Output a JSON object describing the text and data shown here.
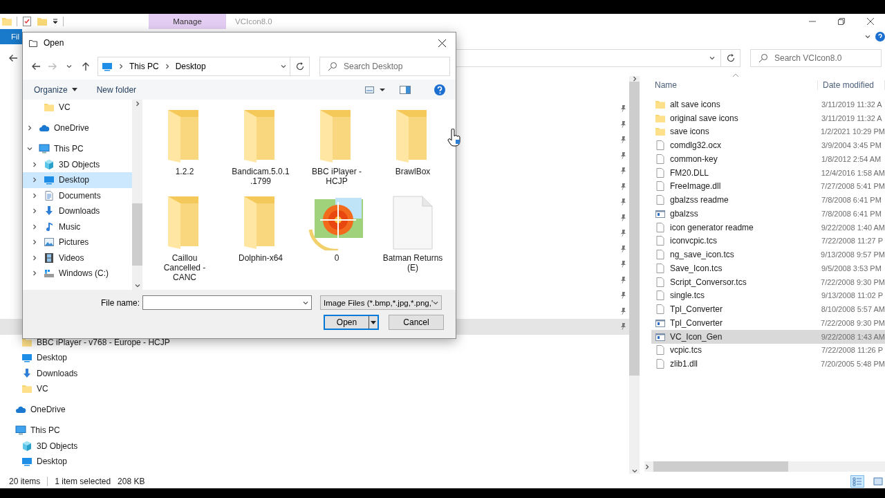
{
  "explorer": {
    "title": "VCIcon8.0",
    "context_tab": "Manage",
    "ribbon_tab": "Fil",
    "search": {
      "placeholder": "Search VCIcon8.0"
    },
    "nav": [
      {
        "children": [
          {
            "pinned": true,
            "selected": false
          },
          {
            "pinned": true,
            "selected": false
          },
          {
            "pinned": true,
            "selected": false
          },
          {
            "pinned": true,
            "selected": false
          },
          {
            "pinned": true,
            "selected": false
          },
          {
            "pinned": true,
            "selected": false
          },
          {
            "pinned": true,
            "selected": false
          },
          {
            "pinned": true,
            "selected": false
          },
          {
            "pinned": true,
            "selected": false
          },
          {
            "pinned": true,
            "selected": false
          },
          {
            "pinned": true,
            "selected": false
          },
          {
            "pinned": true,
            "selected": false
          },
          {
            "pinned": true,
            "selected": false
          },
          {
            "pinned": true,
            "selected": false
          },
          {
            "pinned": true,
            "selected": true
          },
          {
            "label": "BBC iPlayer - v768 - Europe - HCJP",
            "kind": "folder",
            "pinned": false,
            "selected": false
          },
          {
            "label": "Desktop",
            "kind": "desktop",
            "pinned": false,
            "selected": false
          },
          {
            "label": "Downloads",
            "kind": "downloads",
            "pinned": false,
            "selected": false
          },
          {
            "label": "VC",
            "kind": "folder",
            "pinned": false,
            "selected": false
          }
        ]
      },
      {
        "label": "OneDrive",
        "kind": "cloud",
        "selected": false
      },
      {
        "label": "This PC",
        "kind": "pc",
        "selected": false,
        "children": [
          {
            "label": "3D Objects",
            "kind": "cube",
            "selected": false
          },
          {
            "label": "Desktop",
            "kind": "desktop",
            "selected": false
          }
        ]
      }
    ],
    "columns": [
      "Name",
      "Date modified"
    ],
    "files": [
      {
        "name": "alt save icons",
        "date": "3/11/2019 11:32 A",
        "kind": "folder",
        "selected": false
      },
      {
        "name": "original save icons",
        "date": "3/11/2019 11:32 A",
        "kind": "folder",
        "selected": false
      },
      {
        "name": "save icons",
        "date": "1/2/2021 10:29 PM",
        "kind": "folder",
        "selected": false
      },
      {
        "name": "comdlg32.ocx",
        "date": "3/9/2004 3:45 PM",
        "kind": "file",
        "selected": false
      },
      {
        "name": "common-key",
        "date": "1/8/2012 2:54 AM",
        "kind": "file",
        "selected": false
      },
      {
        "name": "FM20.DLL",
        "date": "12/4/2016 1:58 AM",
        "kind": "file",
        "selected": false
      },
      {
        "name": "FreeImage.dll",
        "date": "7/27/2008 5:41 PM",
        "kind": "file",
        "selected": false
      },
      {
        "name": "gbalzss readme",
        "date": "7/8/2008 6:41 PM",
        "kind": "file",
        "selected": false
      },
      {
        "name": "gbalzss",
        "date": "7/8/2008 6:41 PM",
        "kind": "app",
        "selected": false
      },
      {
        "name": "icon generator readme",
        "date": "9/22/2008 1:40 AM",
        "kind": "file",
        "selected": false
      },
      {
        "name": "iconvcpic.tcs",
        "date": "7/22/2008 11:27 P",
        "kind": "file",
        "selected": false
      },
      {
        "name": "ng_save_icon.tcs",
        "date": "9/13/2008 9:57 PM",
        "kind": "file",
        "selected": false
      },
      {
        "name": "Save_Icon.tcs",
        "date": "9/5/2008 3:53 PM",
        "kind": "file",
        "selected": false
      },
      {
        "name": "Script_Conversor.tcs",
        "date": "7/22/2008 9:30 PM",
        "kind": "file",
        "selected": false
      },
      {
        "name": "single.tcs",
        "date": "9/13/2008 11:02 P",
        "kind": "file",
        "selected": false
      },
      {
        "name": "Tpl_Converter",
        "date": "8/10/2008 5:57 AM",
        "kind": "file",
        "selected": false
      },
      {
        "name": "Tpl_Converter",
        "date": "7/22/2008 9:30 PM",
        "kind": "app",
        "selected": false
      },
      {
        "name": "VC_Icon_Gen",
        "date": "9/22/2008 1:43 AM",
        "kind": "app",
        "selected": true
      },
      {
        "name": "vcpic.tcs",
        "date": "7/22/2008 11:26 P",
        "kind": "file",
        "selected": false
      },
      {
        "name": "zlib1.dll",
        "date": "7/20/2005 5:48 PM",
        "kind": "file",
        "selected": false
      }
    ],
    "status": {
      "count": "20 items",
      "selection": "1 item selected",
      "size": "208 KB"
    },
    "view_buttons": [
      {
        "kind": "details",
        "selected": true
      },
      {
        "kind": "large-icons",
        "selected": false
      }
    ]
  },
  "dialog": {
    "title": "Open",
    "back": {
      "disabled": false
    },
    "forward": {
      "disabled": true
    },
    "breadcrumb": [
      "This PC",
      "Desktop"
    ],
    "search": {
      "placeholder": "Search Desktop"
    },
    "organize": "Organize",
    "new_folder": "New folder",
    "tree": [
      {
        "children": [
          {
            "label": "VC",
            "kind": "folder",
            "selected": false
          }
        ]
      },
      {
        "label": "OneDrive",
        "kind": "cloud",
        "expanded": false,
        "selected": false
      },
      {
        "label": "This PC",
        "kind": "pc",
        "expanded": true,
        "selected": false,
        "children": [
          {
            "label": "3D Objects",
            "kind": "cube",
            "expanded": false,
            "selected": false
          },
          {
            "label": "Desktop",
            "kind": "desktop",
            "expanded": false,
            "selected": true
          },
          {
            "label": "Documents",
            "kind": "documents",
            "expanded": false,
            "selected": false
          },
          {
            "label": "Downloads",
            "kind": "downloads",
            "expanded": false,
            "selected": false
          },
          {
            "label": "Music",
            "kind": "music",
            "expanded": false,
            "selected": false
          },
          {
            "label": "Pictures",
            "kind": "pictures",
            "expanded": false,
            "selected": false
          },
          {
            "label": "Videos",
            "kind": "videos",
            "expanded": false,
            "selected": false
          },
          {
            "label": "Windows (C:)",
            "kind": "drive",
            "expanded": false,
            "selected": false
          }
        ]
      }
    ],
    "items": [
      {
        "label": "1.2.2",
        "kind": "folder"
      },
      {
        "label": "Bandicam.5.0.1 .1799",
        "kind": "folder"
      },
      {
        "label": "BBC iPlayer - HCJP",
        "kind": "folder"
      },
      {
        "label": "BrawlBox",
        "kind": "folder"
      },
      {
        "label": "Caillou Cancelled - CANC",
        "kind": "folder"
      },
      {
        "label": "Dolphin-x64",
        "kind": "folder"
      },
      {
        "label": "0",
        "kind": "photo"
      },
      {
        "label": "Batman Returns (E)",
        "kind": "file"
      }
    ],
    "file_name_label": "File name:",
    "filter": "Image Files (*.bmp,*.jpg,*.png,'",
    "buttons": [
      {
        "label": "Open",
        "kind": "split",
        "selected": true
      },
      {
        "label": "Cancel",
        "kind": "plain",
        "selected": false
      }
    ]
  }
}
